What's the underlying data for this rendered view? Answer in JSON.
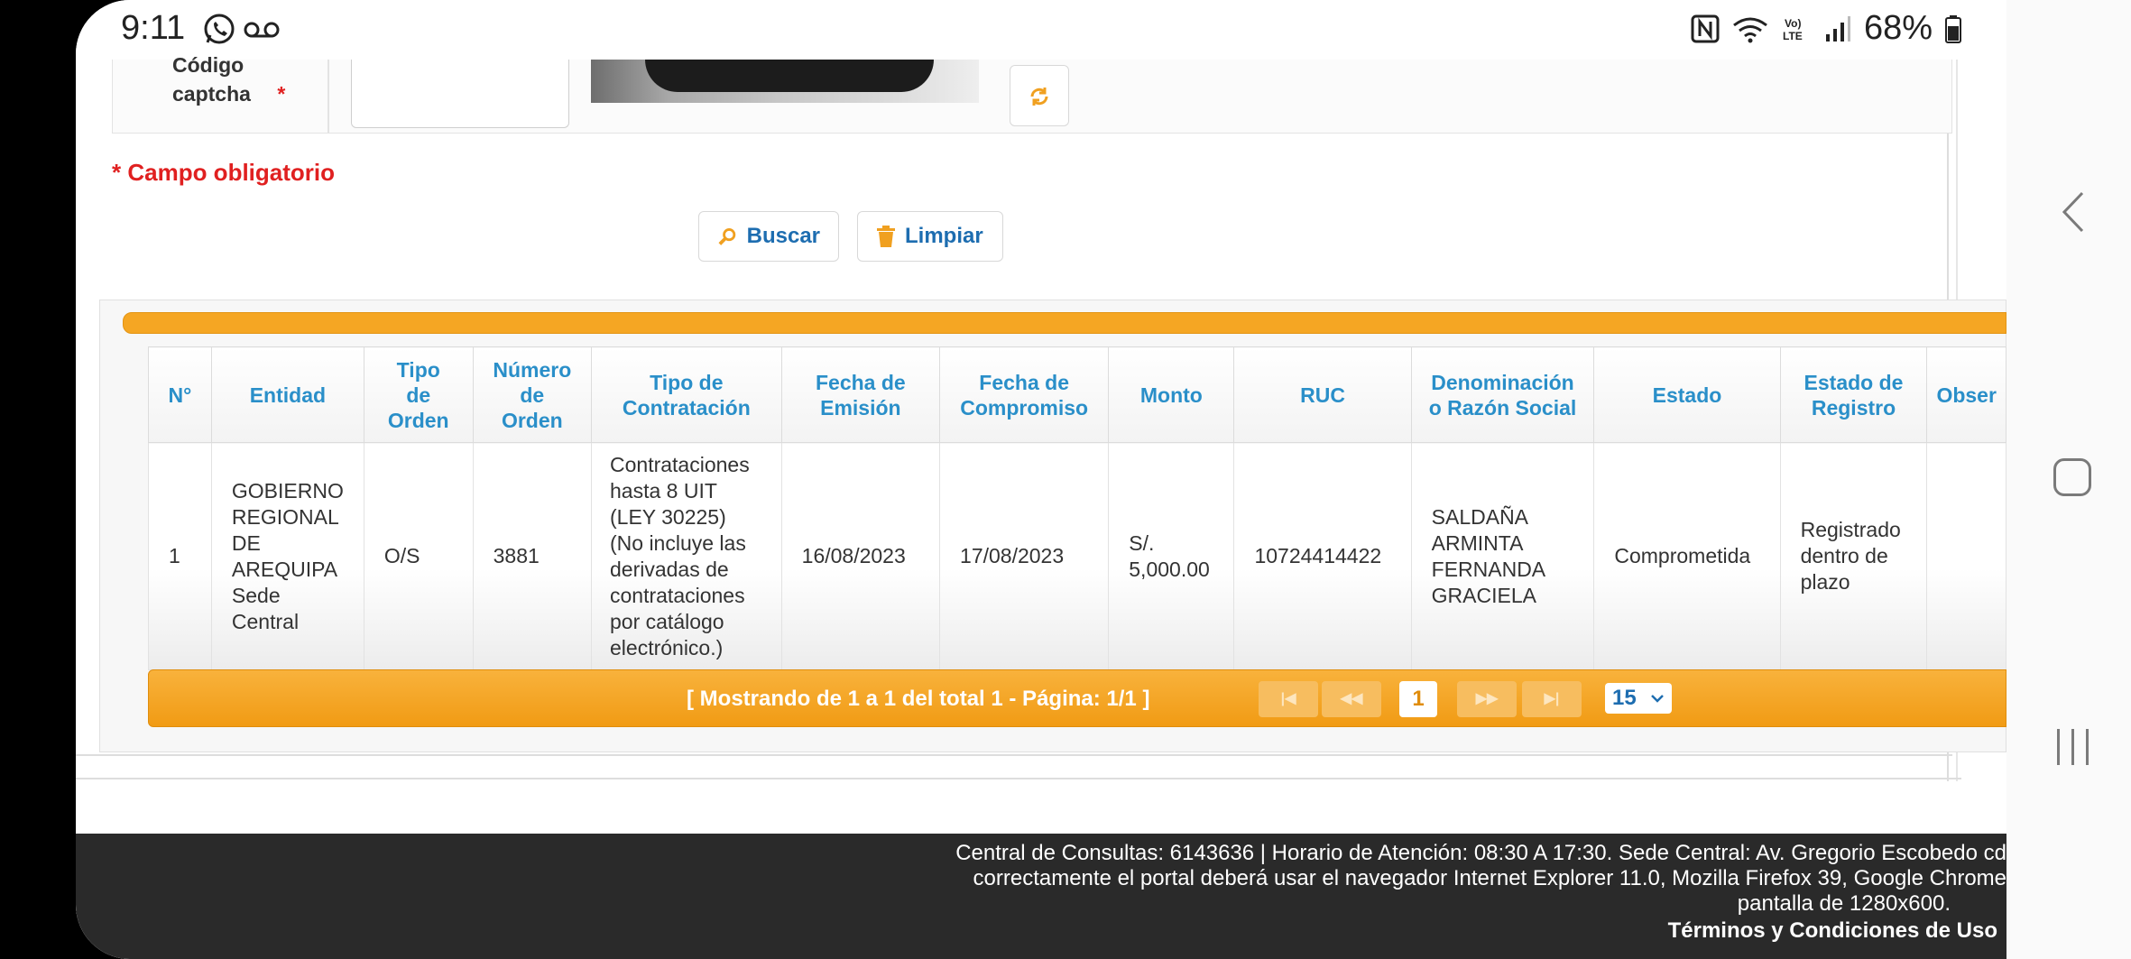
{
  "status_bar": {
    "time": "9:11",
    "battery": "68%"
  },
  "form": {
    "captcha_label": "Código captcha",
    "required_mark": "*",
    "required_note": "* Campo obligatorio",
    "search_label": "Buscar",
    "clear_label": "Limpiar"
  },
  "table": {
    "headers": [
      "N°",
      "Entidad",
      "Tipo de Orden",
      "Número de Orden",
      "Tipo de Contratación",
      "Fecha de Emisión",
      "Fecha de Compromiso",
      "Monto",
      "RUC",
      "Denominación o Razón Social",
      "Estado",
      "Estado de Registro",
      "Obser"
    ],
    "rows": [
      {
        "n": "1",
        "entidad": "GOBIERNO REGIONAL DE AREQUIPA Sede Central",
        "tipo_orden": "O/S",
        "numero_orden": "3881",
        "tipo_contratacion": "Contrataciones hasta 8 UIT (LEY 30225) (No incluye las derivadas de contrataciones por catálogo electrónico.)",
        "fecha_emision": "16/08/2023",
        "fecha_compromiso": "17/08/2023",
        "monto": "S/. 5,000.00",
        "ruc": "10724414422",
        "razon_social": "SALDAÑA ARMINTA FERNANDA GRACIELA",
        "estado": "Comprometida",
        "estado_registro": "Registrado dentro de plazo",
        "observacion": ""
      }
    ]
  },
  "pager": {
    "summary": "[ Mostrando de 1 a 1 del total 1 - Página: 1/1 ]",
    "current_page": "1",
    "page_size": "15",
    "first_label": "|◀",
    "prev_label": "◀◀",
    "next_label": "▶▶",
    "last_label": "▶|"
  },
  "footer": {
    "line1": "Central de Consultas: 6143636 | Horario de Atención: 08:30 A 17:30. Sede Central: Av. Gregorio Escobedo cd",
    "line2": "correctamente el portal deberá usar el navegador Internet Explorer 11.0, Mozilla Firefox 39, Google Chrome",
    "line3": "pantalla de 1280x600.",
    "terms": "Términos y Condiciones de Uso"
  },
  "colors": {
    "accent_orange": "#f5a623",
    "header_blue": "#2a8fc9",
    "required_red": "#e02020"
  },
  "icons": [
    "whatsapp-icon",
    "voicemail-icon",
    "nfc-icon",
    "wifi-icon",
    "volte-icon",
    "signal-icon",
    "battery-icon",
    "refresh-icon",
    "search-icon",
    "trash-icon",
    "chevron-down-icon",
    "back-icon",
    "home-icon",
    "recents-icon"
  ]
}
